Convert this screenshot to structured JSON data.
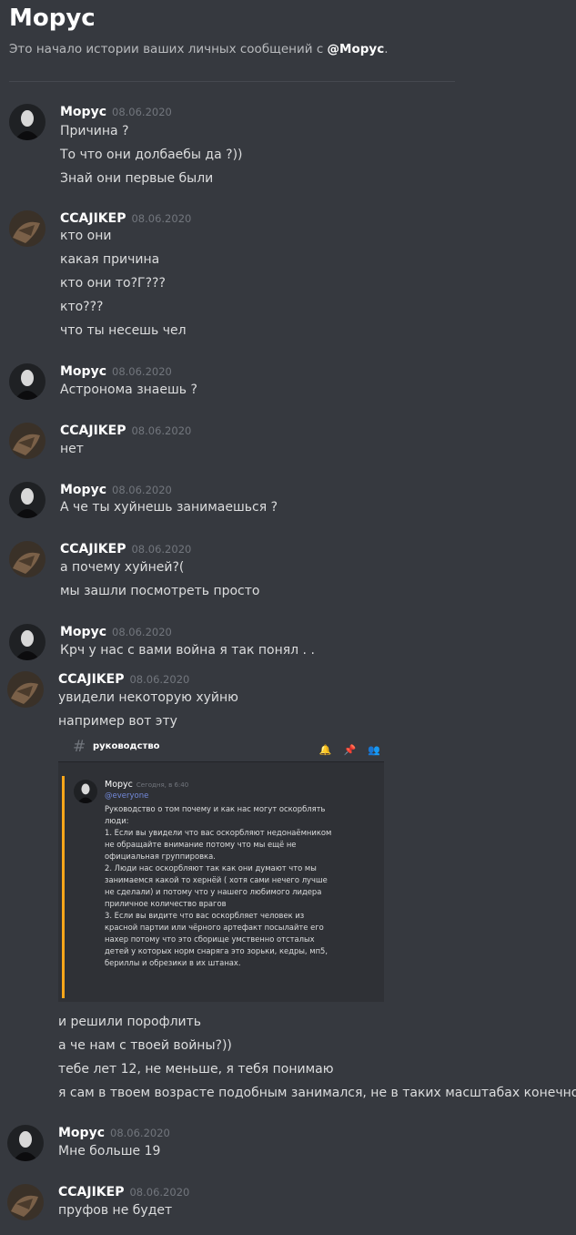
{
  "header": {
    "title": "Морус",
    "subtitle_prefix": "Это начало истории ваших личных сообщений с ",
    "subtitle_mention": "@Морус",
    "subtitle_suffix": "."
  },
  "messages": [
    {
      "author": "Морус",
      "timestamp": "08.06.2020",
      "lines": [
        "Причина ?",
        "То что они долбаебы да ?))",
        "Знай они первые были"
      ]
    },
    {
      "author": "CCAJIKEP",
      "timestamp": "08.06.2020",
      "lines": [
        "кто они",
        "какая причина",
        "кто они то?Г???",
        "кто???",
        "что ты несешь чел"
      ]
    },
    {
      "author": "Морус",
      "timestamp": "08.06.2020",
      "lines": [
        "Астронома знаешь ?"
      ]
    },
    {
      "author": "CCAJIKEP",
      "timestamp": "08.06.2020",
      "lines": [
        "нет"
      ]
    },
    {
      "author": "Морус",
      "timestamp": "08.06.2020",
      "lines": [
        "А че ты хуйнешь занимаешься ?"
      ]
    },
    {
      "author": "CCAJIKEP",
      "timestamp": "08.06.2020",
      "lines": [
        "а почему хуйней?(",
        "мы зашли посмотреть просто"
      ]
    },
    {
      "author": "Морус",
      "timestamp": "08.06.2020",
      "lines": [
        "Крч у нас с вами война я так понял . ."
      ]
    },
    {
      "author": "CCAJIKEP",
      "timestamp": "08.06.2020",
      "lines": [
        "увидели некоторую хуйню",
        "например вот эту",
        "и решили порофлить",
        "а че нам с твоей войны?))",
        "тебе лет 12, не меньше, я тебя понимаю",
        "я сам в твоем возрасте подобным занимался, не в таких масштабах конечно"
      ]
    },
    {
      "author": "Морус",
      "timestamp": "08.06.2020",
      "lines": [
        "Мне больше 19"
      ]
    },
    {
      "author": "CCAJIKEP",
      "timestamp": "08.06.2020",
      "lines": [
        "пруфов не будет"
      ]
    }
  ],
  "attachment": {
    "channel": "руководство",
    "author": "Морус",
    "timestamp": "Сегодня, в 6:40",
    "mention": "@everyone",
    "lines": [
      "Руководство о том почему и как нас могут оскорблять",
      "люди:",
      "1. Если вы увидели что вас оскорбляют недонаёмником",
      "не обращайте внимание потому что мы ещё не",
      "официальная группировка.",
      "2. Люди нас оскорбляют так как они думают что мы",
      "занимаемся какой то хернёй ( хотя сами нечего лучше",
      "не сделали) и потому что у нашего любимого лидера",
      "приличное количество врагов",
      "3. Если вы видите что вас оскорбляет человек из",
      "красной партии или чёрного артефакт посылайте его",
      "нахер потому что это сборище умственно отсталых",
      "детей у которых норм снаряга это зорьки, кедры, мп5,",
      "бериллы и обрезики в их штанах."
    ]
  },
  "colors": {
    "background": "#36393f",
    "text": "#dcddde",
    "author": "#ffffff",
    "timestamp": "#72767d",
    "mention": "#7289da",
    "embed_border": "#faa61a"
  }
}
